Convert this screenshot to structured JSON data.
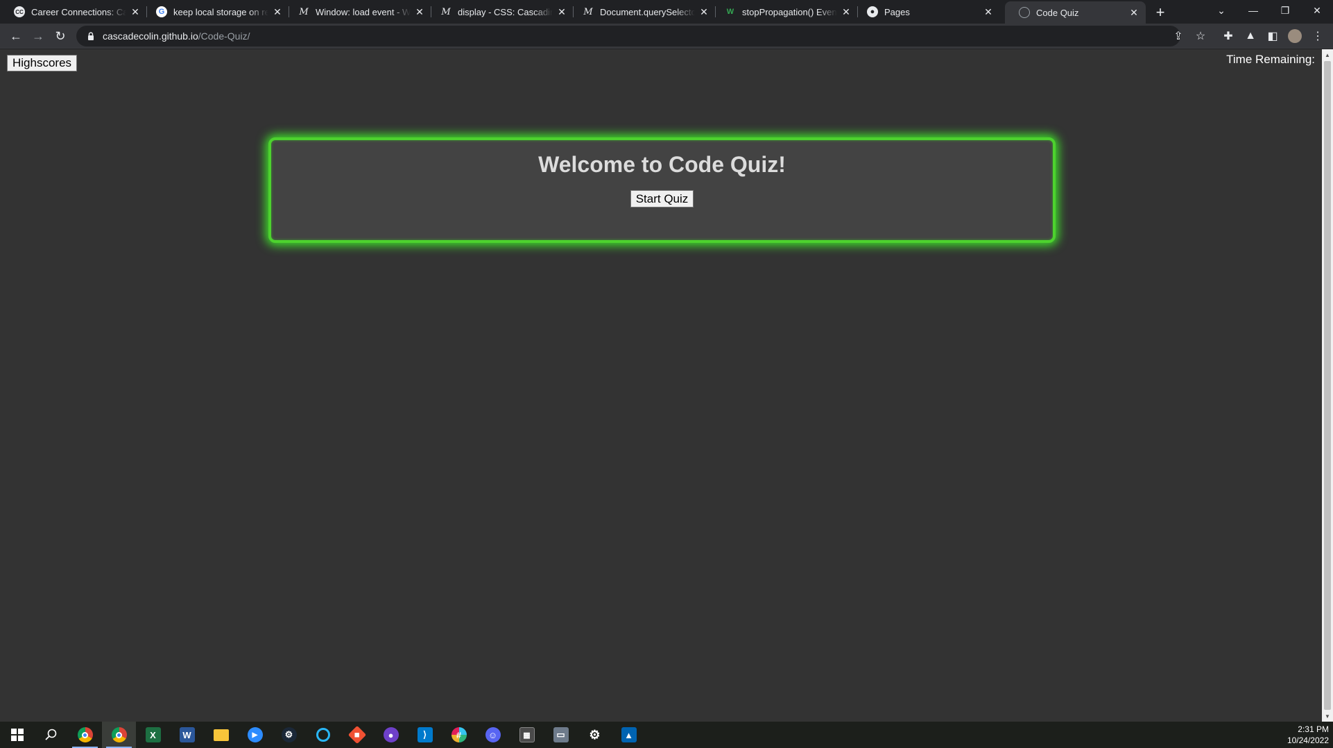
{
  "browser": {
    "tabs": [
      {
        "title": "Career Connections: Caree",
        "favicon": "cc-icon"
      },
      {
        "title": "keep local storage on refre",
        "favicon": "google-icon"
      },
      {
        "title": "Window: load event - Web",
        "favicon": "mdn-icon"
      },
      {
        "title": "display - CSS: Cascading St",
        "favicon": "mdn-icon"
      },
      {
        "title": "Document.querySelector()",
        "favicon": "mdn-icon"
      },
      {
        "title": "stopPropagation() Event M",
        "favicon": "w3schools-icon"
      },
      {
        "title": "Pages",
        "favicon": "github-icon"
      },
      {
        "title": "Code Quiz",
        "favicon": "globe-icon",
        "active": true
      }
    ],
    "new_tab_glyph": "+",
    "address": {
      "host": "cascadecolin.github.io",
      "path": "/Code-Quiz/"
    }
  },
  "page": {
    "highscores_label": "Highscores",
    "time_remaining_label": "Time Remaining:",
    "title": "Welcome to Code Quiz!",
    "start_label": "Start Quiz",
    "accent_color": "#4dd22e",
    "background_color": "#333333"
  },
  "taskbar": {
    "apps": [
      "start-icon",
      "search-icon",
      "chrome-icon",
      "chrome-profile-icon",
      "excel-icon",
      "word-icon",
      "file-explorer-icon",
      "zoom-icon",
      "steam-icon",
      "cortana-icon",
      "git-icon",
      "github-desktop-icon",
      "vscode-icon",
      "slack-icon",
      "discord-icon",
      "calculator-icon",
      "network-icon",
      "settings-icon",
      "photos-icon"
    ],
    "clock": {
      "time": "2:31 PM",
      "date": "10/24/2022"
    }
  }
}
